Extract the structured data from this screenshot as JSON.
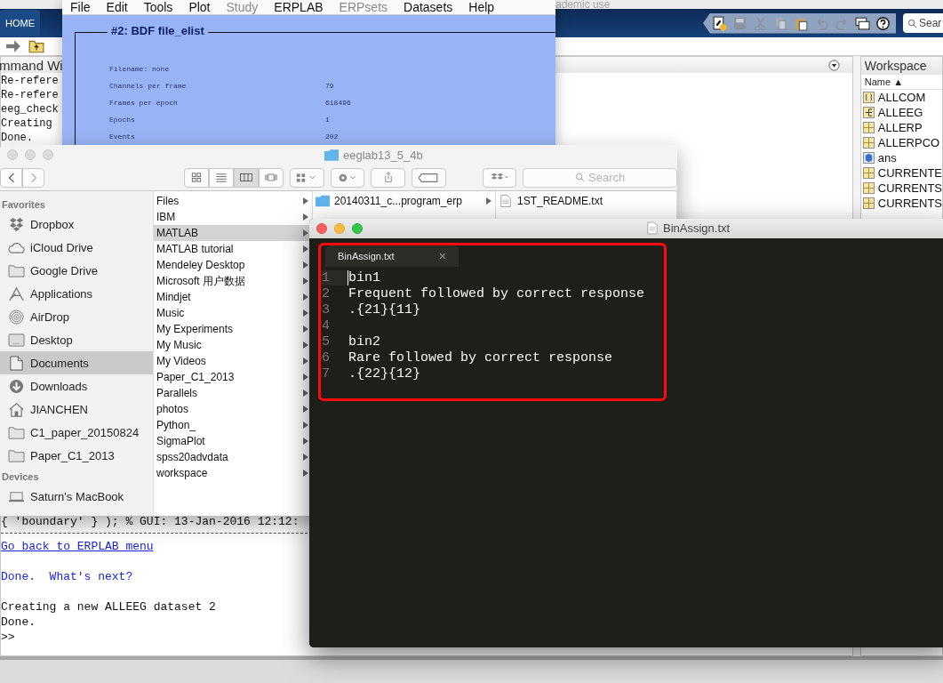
{
  "matlab": {
    "title": "ademic use",
    "tabs": [
      {
        "label": "HOME",
        "selected": true
      }
    ],
    "search": {
      "placeholder": "Sear"
    },
    "command_window": {
      "title": "mmand Wi",
      "lines_top": [
        "Re-refere",
        "Re-refere",
        "eeg_check",
        "Creating",
        "Done."
      ],
      "lines_bottom": [
        {
          "kind": "code",
          "text": "{ 'boundary' } ); % GUI: 13-Jan-2016 12:12:"
        },
        {
          "kind": "rule"
        },
        {
          "kind": "link",
          "text": "Go back to ERPLAB menu"
        },
        {
          "kind": "blank"
        },
        {
          "kind": "info",
          "text": "Done.  What's next?"
        },
        {
          "kind": "blank"
        },
        {
          "kind": "code",
          "text": "Creating a new ALLEEG dataset 2"
        },
        {
          "kind": "code",
          "text": "Done."
        },
        {
          "kind": "code",
          "text": ">>"
        }
      ]
    },
    "workspace": {
      "title": "Workspace",
      "column": "Name ▲",
      "items": [
        {
          "name": "ALLCOM",
          "kind": "struct"
        },
        {
          "name": "ALLEEG",
          "kind": "tree"
        },
        {
          "name": "ALLERP",
          "kind": "grid"
        },
        {
          "name": "ALLERPCO",
          "kind": "grid"
        },
        {
          "name": "ans",
          "kind": "object"
        },
        {
          "name": "CURRENTE",
          "kind": "grid"
        },
        {
          "name": "CURRENTS",
          "kind": "grid"
        },
        {
          "name": "CURRENTS",
          "kind": "grid"
        }
      ]
    }
  },
  "eeglab": {
    "menu": [
      {
        "label": "File",
        "disabled": false
      },
      {
        "label": "Edit",
        "disabled": false
      },
      {
        "label": "Tools",
        "disabled": false
      },
      {
        "label": "Plot",
        "disabled": false
      },
      {
        "label": "Study",
        "disabled": true
      },
      {
        "label": "ERPLAB",
        "disabled": false
      },
      {
        "label": "ERPsets",
        "disabled": true
      },
      {
        "label": "Datasets",
        "disabled": false
      },
      {
        "label": "Help",
        "disabled": false
      }
    ],
    "panel_title": "#2: BDF file_elist",
    "fields": [
      {
        "label": "Filename: none"
      },
      {
        "label": "Channels per frame",
        "value": "79"
      },
      {
        "label": "Frames per epoch",
        "value": "618496"
      },
      {
        "label": "Epochs",
        "value": "1"
      },
      {
        "label": "Events",
        "value": "202"
      }
    ]
  },
  "finder": {
    "title": "eeglab13_5_4b",
    "search": {
      "placeholder": "Search"
    },
    "sidebar": [
      {
        "heading": "Favorites",
        "items": [
          {
            "label": "Dropbox",
            "kind": "dropbox",
            "selected": false
          },
          {
            "label": "iCloud Drive",
            "kind": "cloud",
            "selected": false
          },
          {
            "label": "Google Drive",
            "kind": "folder",
            "selected": false
          },
          {
            "label": "Applications",
            "kind": "apps",
            "selected": false
          },
          {
            "label": "AirDrop",
            "kind": "airdrop",
            "selected": false
          },
          {
            "label": "Desktop",
            "kind": "desktop",
            "selected": false
          },
          {
            "label": "Documents",
            "kind": "document",
            "selected": true
          },
          {
            "label": "Downloads",
            "kind": "download",
            "selected": false
          },
          {
            "label": "JIANCHEN",
            "kind": "home",
            "selected": false
          },
          {
            "label": "C1_paper_20150824",
            "kind": "folder",
            "selected": false
          },
          {
            "label": "Paper_C1_2013",
            "kind": "folder",
            "selected": false
          }
        ]
      },
      {
        "heading": "Devices",
        "items": [
          {
            "label": "Saturn's MacBook",
            "kind": "laptop",
            "selected": false
          }
        ]
      }
    ],
    "columns": [
      [
        {
          "label": "Files",
          "selected": false
        },
        {
          "label": "IBM",
          "selected": false
        },
        {
          "label": "MATLAB",
          "selected": true
        },
        {
          "label": "MATLAB tutorial",
          "selected": false
        },
        {
          "label": "Mendeley Desktop",
          "selected": false
        },
        {
          "label": "Microsoft 用户数据",
          "selected": false
        },
        {
          "label": "Mindjet",
          "selected": false
        },
        {
          "label": "Music",
          "selected": false
        },
        {
          "label": "My Experiments",
          "selected": false
        },
        {
          "label": "My Music",
          "selected": false
        },
        {
          "label": "My Videos",
          "selected": false
        },
        {
          "label": "Paper_C1_2013",
          "selected": false
        },
        {
          "label": "Parallels",
          "selected": false
        },
        {
          "label": "photos",
          "selected": false
        },
        {
          "label": "Python_",
          "selected": false
        },
        {
          "label": "SigmaPlot",
          "selected": false
        },
        {
          "label": "spss20advdata",
          "selected": false
        },
        {
          "label": "workspace",
          "selected": false
        }
      ],
      [
        {
          "label": "20140311_c...program_erp",
          "selected": false
        }
      ],
      [
        {
          "label": "1ST_README.txt",
          "selected": false
        }
      ]
    ]
  },
  "editor": {
    "title": "BinAssign.txt",
    "tab": {
      "label": "BinAssign.txt",
      "close": "×"
    },
    "lines": [
      {
        "number": "1",
        "text": "bin1"
      },
      {
        "number": "2",
        "text": "Frequent followed by correct response"
      },
      {
        "number": "3",
        "text": ".{21}{11}"
      },
      {
        "number": "4"
      },
      {
        "number": "5",
        "text": "bin2"
      },
      {
        "number": "6",
        "text": "Rare followed by correct response"
      },
      {
        "number": "7",
        "text": ".{22}{12}"
      }
    ]
  }
}
